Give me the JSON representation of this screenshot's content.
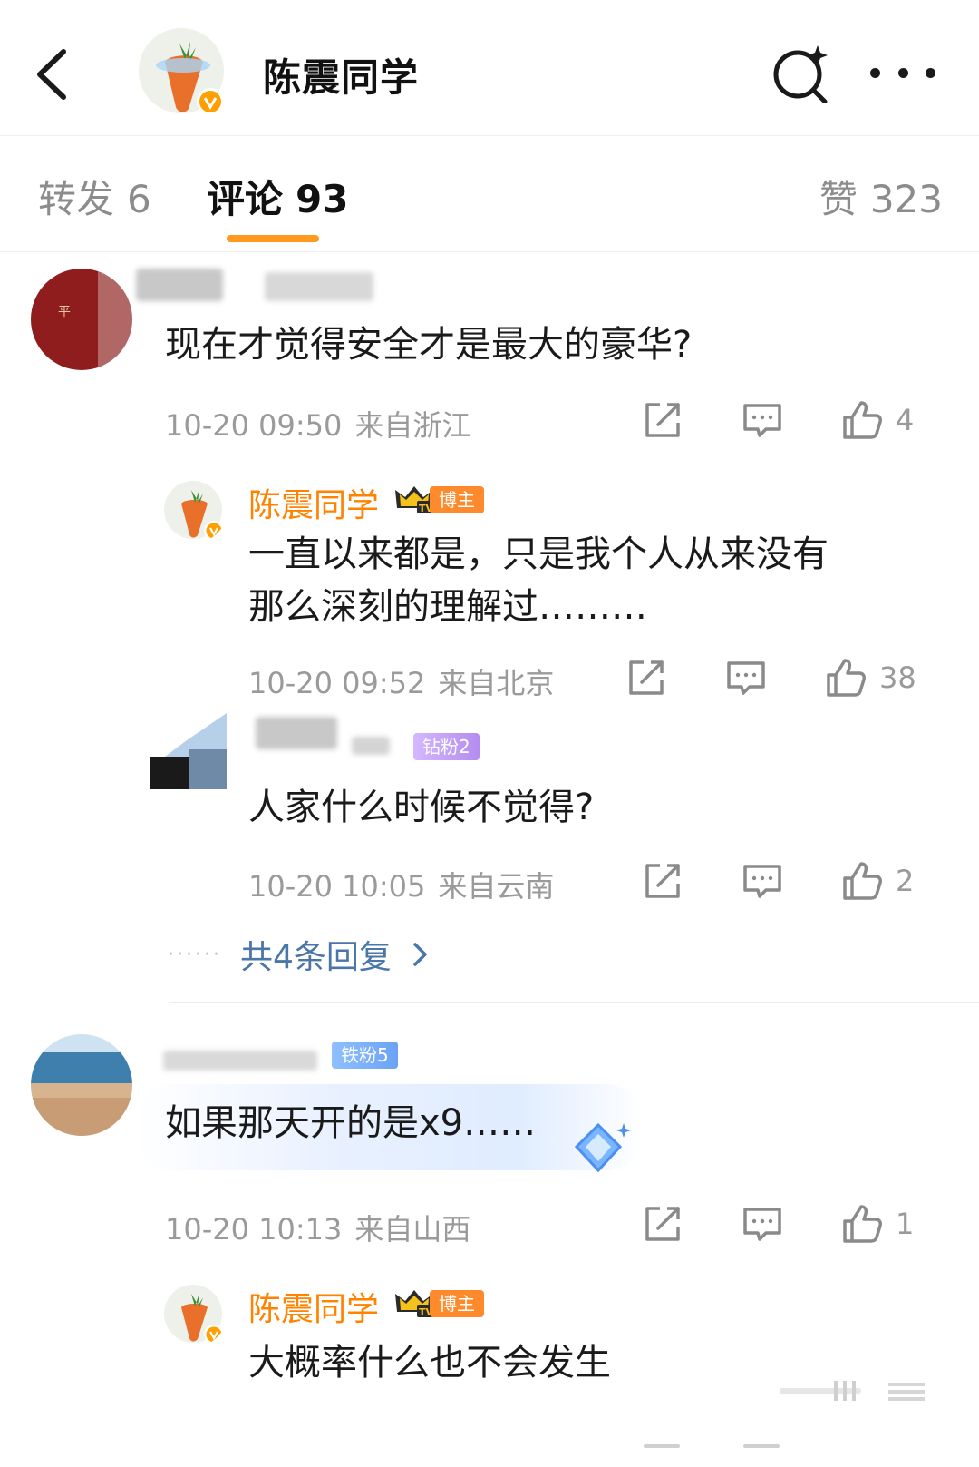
{
  "header": {
    "title": "陈震同学",
    "back_icon": "chevron-left-icon",
    "search_icon": "search-sparkle-icon",
    "more_icon": "more-dots-icon"
  },
  "tabs": [
    {
      "label": "转发",
      "count": "6"
    },
    {
      "label": "评论",
      "count": "93",
      "active": true
    },
    {
      "label": "赞",
      "count": "323"
    }
  ],
  "colors": {
    "accent": "#ff8200",
    "tab_underline": "#ff9a1f",
    "link": "#4a76a8",
    "meta": "#9a9a9a",
    "badge_blogger": "#ff8a2b",
    "badge_fan_purple": "#b48cf0",
    "badge_fan_blue": "#6aa2f5"
  },
  "comments": [
    {
      "text": "现在才觉得安全才是最大的豪华?",
      "time": "10-20 09:50",
      "location": "来自浙江",
      "likes": "4",
      "replies": [
        {
          "name": "陈震同学",
          "badge": "博主",
          "text_lines": [
            "一直以来都是，只是我个人从来没有",
            "那么深刻的理解过………"
          ],
          "time": "10-20 09:52",
          "location": "来自北京",
          "likes": "38"
        },
        {
          "fan_badge": "钻粉2",
          "text": "人家什么时候不觉得?",
          "time": "10-20 10:05",
          "location": "来自云南",
          "likes": "2"
        }
      ],
      "more_replies": "共4条回复"
    },
    {
      "fan_badge": "铁粉5",
      "text": "如果那天开的是x9……",
      "time": "10-20 10:13",
      "location": "来自山西",
      "likes": "1",
      "replies": [
        {
          "name": "陈震同学",
          "badge": "博主",
          "text": "大概率什么也不会发生"
        }
      ]
    }
  ]
}
